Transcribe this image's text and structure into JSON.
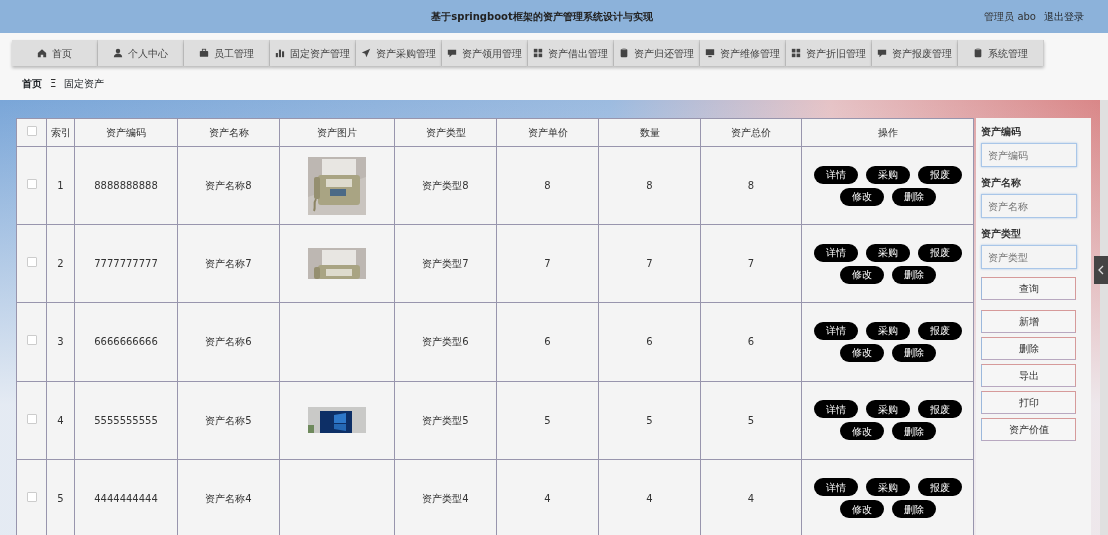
{
  "header": {
    "title": "基于springboot框架的资产管理系统设计与实现",
    "user": "管理员 abo",
    "logout": "退出登录"
  },
  "nav": [
    {
      "label": "首页"
    },
    {
      "label": "个人中心"
    },
    {
      "label": "员工管理"
    },
    {
      "label": "固定资产管理"
    },
    {
      "label": "资产采购管理"
    },
    {
      "label": "资产领用管理"
    },
    {
      "label": "资产借出管理"
    },
    {
      "label": "资产归还管理"
    },
    {
      "label": "资产维修管理"
    },
    {
      "label": "资产折旧管理"
    },
    {
      "label": "资产报废管理"
    },
    {
      "label": "系统管理"
    }
  ],
  "breadcrumb": {
    "items": [
      "首页",
      "固定资产"
    ],
    "separator": "Ξ"
  },
  "table": {
    "select_all_checked": false,
    "columns": [
      "索引",
      "资产编码",
      "资产名称",
      "资产图片",
      "资产类型",
      "资产单价",
      "数量",
      "资产总价",
      "操作"
    ],
    "rows": [
      {
        "checked": false,
        "index": "1",
        "code": "8888888888",
        "name": "资产名称8",
        "type": "资产类型8",
        "price": "8",
        "qty": "8",
        "total": "8",
        "actions": [
          "详情",
          "采购",
          "报废",
          "修改",
          "删除"
        ]
      },
      {
        "checked": false,
        "index": "2",
        "code": "7777777777",
        "name": "资产名称7",
        "type": "资产类型7",
        "price": "7",
        "qty": "7",
        "total": "7",
        "actions": [
          "详情",
          "采购",
          "报废",
          "修改",
          "删除"
        ]
      },
      {
        "checked": false,
        "index": "3",
        "code": "6666666666",
        "name": "资产名称6",
        "type": "资产类型6",
        "price": "6",
        "qty": "6",
        "total": "6",
        "actions": [
          "详情",
          "采购",
          "报废",
          "修改",
          "删除"
        ]
      },
      {
        "checked": false,
        "index": "4",
        "code": "5555555555",
        "name": "资产名称5",
        "type": "资产类型5",
        "price": "5",
        "qty": "5",
        "total": "5",
        "actions": [
          "详情",
          "采购",
          "报废",
          "修改",
          "删除"
        ]
      },
      {
        "checked": false,
        "index": "5",
        "code": "4444444444",
        "name": "资产名称4",
        "type": "资产类型4",
        "price": "4",
        "qty": "4",
        "total": "4",
        "actions": [
          "详情",
          "采购",
          "报废",
          "修改",
          "删除"
        ]
      }
    ]
  },
  "search": {
    "fields": [
      {
        "label": "资产编码",
        "placeholder": "资产编码"
      },
      {
        "label": "资产名称",
        "placeholder": "资产名称"
      },
      {
        "label": "资产类型",
        "placeholder": "资产类型"
      }
    ],
    "button": "查询"
  },
  "buttons": [
    "新增",
    "删除",
    "导出",
    "打印",
    "资产价值"
  ]
}
